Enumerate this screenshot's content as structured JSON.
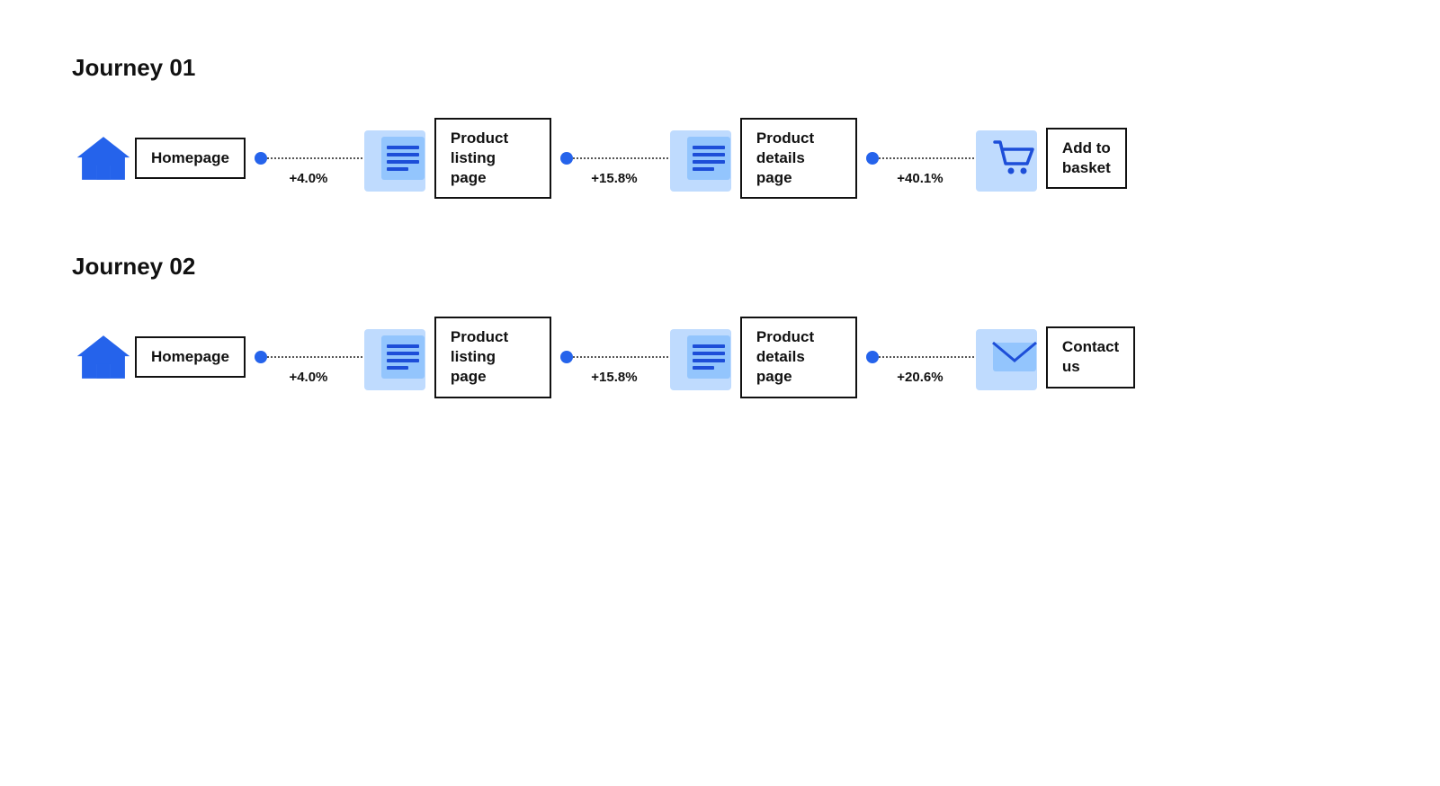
{
  "journeys": [
    {
      "id": "journey-01",
      "title": "Journey 01",
      "steps": [
        {
          "icon": "home",
          "label": "Homepage"
        },
        {
          "connector_pct": "+4.0%",
          "icon": "page",
          "label": "Product\nlisting page"
        },
        {
          "connector_pct": "+15.8%",
          "icon": "page",
          "label": "Product\ndetails page"
        },
        {
          "connector_pct": "+40.1%",
          "icon": "cart",
          "label": "Add to\nbasket"
        }
      ]
    },
    {
      "id": "journey-02",
      "title": "Journey 02",
      "steps": [
        {
          "icon": "home",
          "label": "Homepage"
        },
        {
          "connector_pct": "+4.0%",
          "icon": "page",
          "label": "Product\nlisting page"
        },
        {
          "connector_pct": "+15.8%",
          "icon": "page",
          "label": "Product\ndetails page"
        },
        {
          "connector_pct": "+20.6%",
          "icon": "envelope",
          "label": "Contact\nus"
        }
      ]
    }
  ]
}
